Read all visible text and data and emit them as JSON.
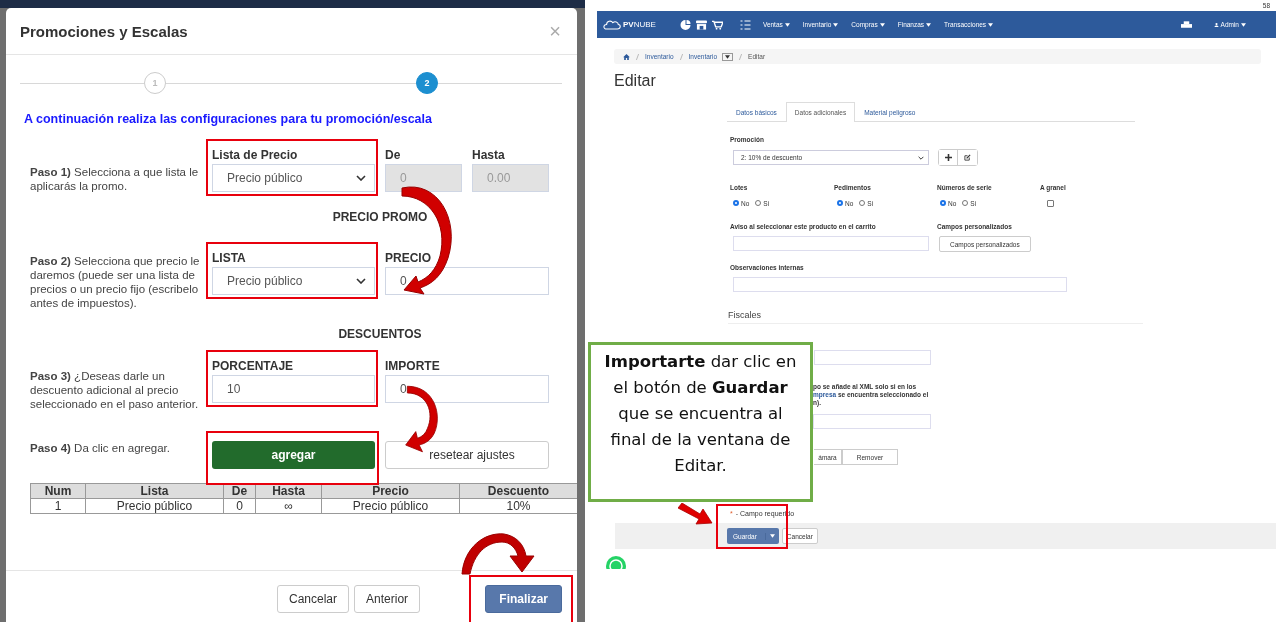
{
  "modal": {
    "title": "Promociones y Escalas",
    "close": "×",
    "steps": [
      {
        "label": "1",
        "selected": false
      },
      {
        "label": "2",
        "selected": true
      }
    ],
    "intro": "A continuación realiza las configuraciones para tu promoción/escala",
    "paso1": {
      "step": "**Paso 1)** Selecciona a que lista le aplicarás la promo.",
      "list": {
        "label": "Lista de Precio",
        "value": "Precio público",
        "highlighted": true
      },
      "de": {
        "label": "De",
        "value": "0",
        "disabled": true
      },
      "hasta": {
        "label": "Hasta",
        "value": "0.00",
        "disabled": true
      }
    },
    "precio_promo_heading": "PRECIO PROMO",
    "paso2": {
      "step": "**Paso 2)** Selecciona que precio le daremos (puede ser una lista de precios o un precio fijo (escribelo antes de impuestos).",
      "list": {
        "label": "LISTA",
        "value": "Precio público",
        "highlighted": true
      },
      "precio": {
        "label": "PRECIO",
        "value": "0",
        "disabled": false
      }
    },
    "descuentos_heading": "DESCUENTOS",
    "paso3": {
      "step": "**Paso 3)** ¿Deseas darle un descuento adicional al precio seleccionado en el paso anterior.",
      "porcentaje": {
        "label": "PORCENTAJE",
        "value": "10",
        "highlighted": true
      },
      "importe": {
        "label": "IMPORTE",
        "value": "0",
        "disabled": false
      }
    },
    "paso4": {
      "step": "**Paso 4)** Da clic en agregar.",
      "add": {
        "label": "agregar",
        "highlighted": true
      },
      "reset": {
        "label": "resetear ajustes"
      }
    },
    "table": {
      "columns": [
        "Num",
        "Lista",
        "De",
        "Hasta",
        "Precio",
        "Descuento"
      ],
      "rows": [
        [
          "1",
          "Precio público",
          "0",
          "∞",
          "Precio público",
          "10%"
        ]
      ]
    },
    "footer_buttons": [
      {
        "label": "Cancelar",
        "kind": "default",
        "highlighted": false
      },
      {
        "label": "Anterior",
        "kind": "default",
        "highlighted": false
      },
      {
        "label": "Finalizar",
        "kind": "primary",
        "highlighted": true
      }
    ]
  },
  "app": {
    "navbar": {
      "logo": "**PV**NUBE",
      "menus": [
        "Ventas",
        "Inventario",
        "Compras",
        "Finanzas",
        "Transacciones"
      ],
      "user": "Admin",
      "badge": "58"
    },
    "breadcrumb": [
      {
        "label": "Inventario",
        "dropdown": false
      },
      {
        "label": "Inventario",
        "dropdown": true
      },
      {
        "label": "Editar",
        "dropdown": false
      }
    ],
    "title": "Editar",
    "tabs": [
      {
        "label": "Datos básicos",
        "selected": false
      },
      {
        "label": "Datos adicionales",
        "selected": true
      },
      {
        "label": "Material peligroso",
        "selected": false
      }
    ],
    "promocion": {
      "label": "Promoción",
      "value": "2: 10% de descuento"
    },
    "radio_groups": [
      {
        "label": "Lotes",
        "options": [
          {
            "label": "No",
            "selected": true
          },
          {
            "label": "Si",
            "selected": false
          }
        ]
      },
      {
        "label": "Pedimentos",
        "options": [
          {
            "label": "No",
            "selected": true
          },
          {
            "label": "Si",
            "selected": false
          }
        ]
      },
      {
        "label": "Números de serie",
        "options": [
          {
            "label": "No",
            "selected": true
          },
          {
            "label": "Si",
            "selected": false
          }
        ]
      }
    ],
    "granel": {
      "label": "A granel",
      "checked": false
    },
    "aviso": {
      "label": "Aviso al seleccionar este producto en el carrito"
    },
    "campos": {
      "label": "Campos personalizados",
      "button": "Campos personalizados"
    },
    "observaciones": {
      "label": "Observaciones internas"
    },
    "fiscales": "Fiscales",
    "note_line1": "po se añade al XML solo si en los",
    "note_link": "mpresa",
    "note_link_rest": " se encuentra seleccionado el",
    "note_line3": "n).",
    "image_buttons": [
      "ámara",
      "Remover"
    ],
    "required_mark": "*",
    "required_text": "- Campo requerido",
    "save": {
      "label": "Guardar",
      "highlighted": true
    },
    "cancel": "Cancelar",
    "callout": "**Importarte** dar clic en el botón de **Guardar** que se encuentra al final de la ventana de Editar."
  }
}
